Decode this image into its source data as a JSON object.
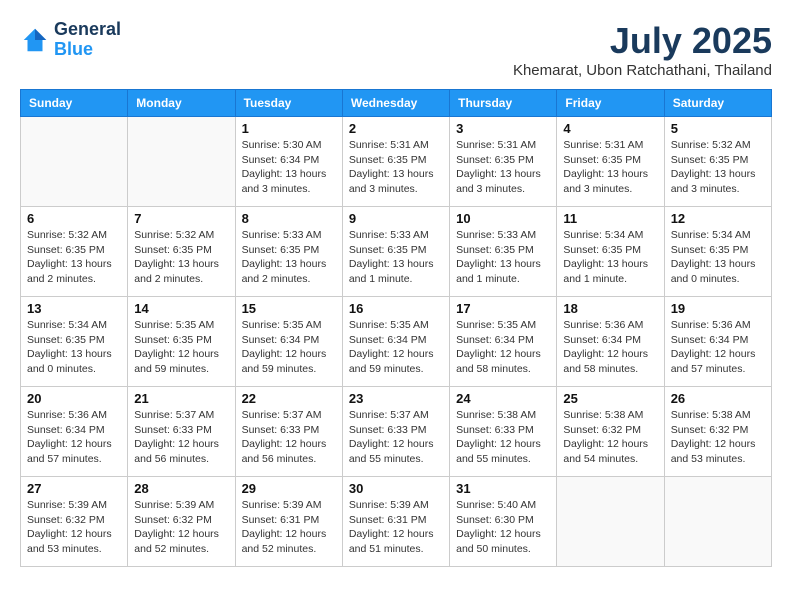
{
  "header": {
    "logo_line1": "General",
    "logo_line2": "Blue",
    "title": "July 2025",
    "subtitle": "Khemarat, Ubon Ratchathani, Thailand"
  },
  "days_of_week": [
    "Sunday",
    "Monday",
    "Tuesday",
    "Wednesday",
    "Thursday",
    "Friday",
    "Saturday"
  ],
  "weeks": [
    [
      {
        "day": "",
        "info": ""
      },
      {
        "day": "",
        "info": ""
      },
      {
        "day": "1",
        "info": "Sunrise: 5:30 AM\nSunset: 6:34 PM\nDaylight: 13 hours and 3 minutes."
      },
      {
        "day": "2",
        "info": "Sunrise: 5:31 AM\nSunset: 6:35 PM\nDaylight: 13 hours and 3 minutes."
      },
      {
        "day": "3",
        "info": "Sunrise: 5:31 AM\nSunset: 6:35 PM\nDaylight: 13 hours and 3 minutes."
      },
      {
        "day": "4",
        "info": "Sunrise: 5:31 AM\nSunset: 6:35 PM\nDaylight: 13 hours and 3 minutes."
      },
      {
        "day": "5",
        "info": "Sunrise: 5:32 AM\nSunset: 6:35 PM\nDaylight: 13 hours and 3 minutes."
      }
    ],
    [
      {
        "day": "6",
        "info": "Sunrise: 5:32 AM\nSunset: 6:35 PM\nDaylight: 13 hours and 2 minutes."
      },
      {
        "day": "7",
        "info": "Sunrise: 5:32 AM\nSunset: 6:35 PM\nDaylight: 13 hours and 2 minutes."
      },
      {
        "day": "8",
        "info": "Sunrise: 5:33 AM\nSunset: 6:35 PM\nDaylight: 13 hours and 2 minutes."
      },
      {
        "day": "9",
        "info": "Sunrise: 5:33 AM\nSunset: 6:35 PM\nDaylight: 13 hours and 1 minute."
      },
      {
        "day": "10",
        "info": "Sunrise: 5:33 AM\nSunset: 6:35 PM\nDaylight: 13 hours and 1 minute."
      },
      {
        "day": "11",
        "info": "Sunrise: 5:34 AM\nSunset: 6:35 PM\nDaylight: 13 hours and 1 minute."
      },
      {
        "day": "12",
        "info": "Sunrise: 5:34 AM\nSunset: 6:35 PM\nDaylight: 13 hours and 0 minutes."
      }
    ],
    [
      {
        "day": "13",
        "info": "Sunrise: 5:34 AM\nSunset: 6:35 PM\nDaylight: 13 hours and 0 minutes."
      },
      {
        "day": "14",
        "info": "Sunrise: 5:35 AM\nSunset: 6:35 PM\nDaylight: 12 hours and 59 minutes."
      },
      {
        "day": "15",
        "info": "Sunrise: 5:35 AM\nSunset: 6:34 PM\nDaylight: 12 hours and 59 minutes."
      },
      {
        "day": "16",
        "info": "Sunrise: 5:35 AM\nSunset: 6:34 PM\nDaylight: 12 hours and 59 minutes."
      },
      {
        "day": "17",
        "info": "Sunrise: 5:35 AM\nSunset: 6:34 PM\nDaylight: 12 hours and 58 minutes."
      },
      {
        "day": "18",
        "info": "Sunrise: 5:36 AM\nSunset: 6:34 PM\nDaylight: 12 hours and 58 minutes."
      },
      {
        "day": "19",
        "info": "Sunrise: 5:36 AM\nSunset: 6:34 PM\nDaylight: 12 hours and 57 minutes."
      }
    ],
    [
      {
        "day": "20",
        "info": "Sunrise: 5:36 AM\nSunset: 6:34 PM\nDaylight: 12 hours and 57 minutes."
      },
      {
        "day": "21",
        "info": "Sunrise: 5:37 AM\nSunset: 6:33 PM\nDaylight: 12 hours and 56 minutes."
      },
      {
        "day": "22",
        "info": "Sunrise: 5:37 AM\nSunset: 6:33 PM\nDaylight: 12 hours and 56 minutes."
      },
      {
        "day": "23",
        "info": "Sunrise: 5:37 AM\nSunset: 6:33 PM\nDaylight: 12 hours and 55 minutes."
      },
      {
        "day": "24",
        "info": "Sunrise: 5:38 AM\nSunset: 6:33 PM\nDaylight: 12 hours and 55 minutes."
      },
      {
        "day": "25",
        "info": "Sunrise: 5:38 AM\nSunset: 6:32 PM\nDaylight: 12 hours and 54 minutes."
      },
      {
        "day": "26",
        "info": "Sunrise: 5:38 AM\nSunset: 6:32 PM\nDaylight: 12 hours and 53 minutes."
      }
    ],
    [
      {
        "day": "27",
        "info": "Sunrise: 5:39 AM\nSunset: 6:32 PM\nDaylight: 12 hours and 53 minutes."
      },
      {
        "day": "28",
        "info": "Sunrise: 5:39 AM\nSunset: 6:32 PM\nDaylight: 12 hours and 52 minutes."
      },
      {
        "day": "29",
        "info": "Sunrise: 5:39 AM\nSunset: 6:31 PM\nDaylight: 12 hours and 52 minutes."
      },
      {
        "day": "30",
        "info": "Sunrise: 5:39 AM\nSunset: 6:31 PM\nDaylight: 12 hours and 51 minutes."
      },
      {
        "day": "31",
        "info": "Sunrise: 5:40 AM\nSunset: 6:30 PM\nDaylight: 12 hours and 50 minutes."
      },
      {
        "day": "",
        "info": ""
      },
      {
        "day": "",
        "info": ""
      }
    ]
  ]
}
